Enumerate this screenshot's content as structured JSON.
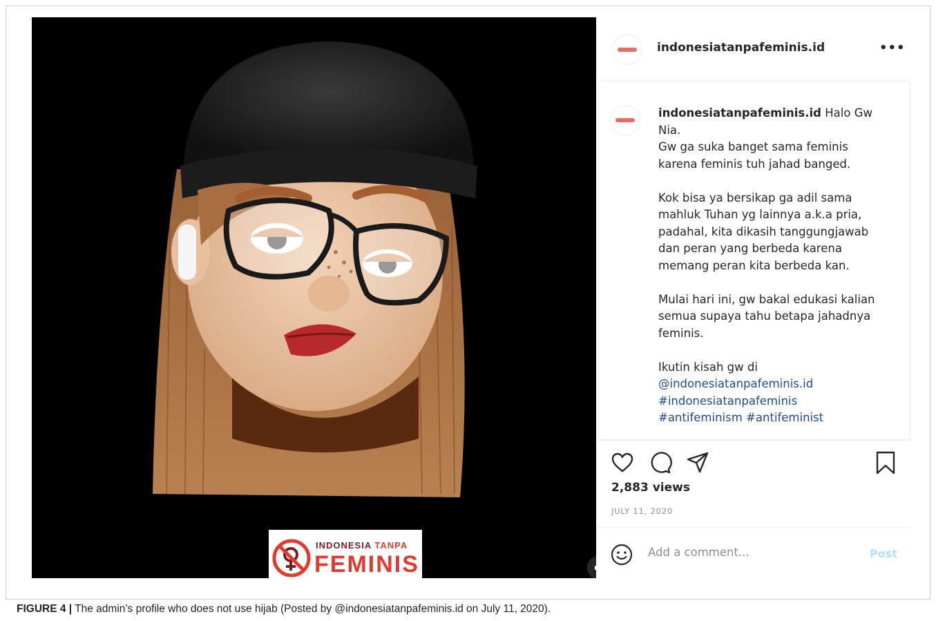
{
  "media": {
    "brand_top_a": "INDONESIA ",
    "brand_top_b": "TANPA",
    "brand_main": "FEMINIS",
    "brand_logo_icon": "no-venus-symbol-icon",
    "mute_icon": "speaker-muted-icon",
    "brand_color": "#e23a2e"
  },
  "post": {
    "username": "indonesiatanpafeminis.id",
    "more_icon": "more-horizontal-icon",
    "caption_username": "indonesiatanpafeminis.id",
    "caption_p1": "Halo Gw Nia.",
    "caption_p1b": "Gw ga suka banget sama feminis karena feminis tuh jahad banged.",
    "caption_p2": "Kok bisa ya bersikap ga adil sama mahluk Tuhan yg lainnya a.k.a pria, padahal, kita dikasih tanggungjawab dan peran yang berbeda karena memang peran kita berbeda kan.",
    "caption_p3": "Mulai hari ini, gw bakal edukasi kalian semua supaya tahu betapa jahadnya feminis.",
    "caption_p4": "Ikutin kisah gw di",
    "mention": "@indonesiatanpafeminis.id",
    "hashtag1": "#indonesiatanpafeminis",
    "hashtags2": "#antifeminism #antifeminist",
    "link_color": "#1f4a8a",
    "views": "2,883 views",
    "date": "JULY 11, 2020",
    "comment_placeholder": "Add a comment...",
    "post_label": "Post",
    "icons": [
      "heart-icon",
      "comment-icon",
      "share-icon",
      "bookmark-icon",
      "emoji-icon"
    ]
  },
  "figure": {
    "label": "FIGURE 4 |",
    "text": " The admin’s profile who does not use hijab (Posted by @indonesiatanpafeminis.id on July 11, 2020)."
  }
}
